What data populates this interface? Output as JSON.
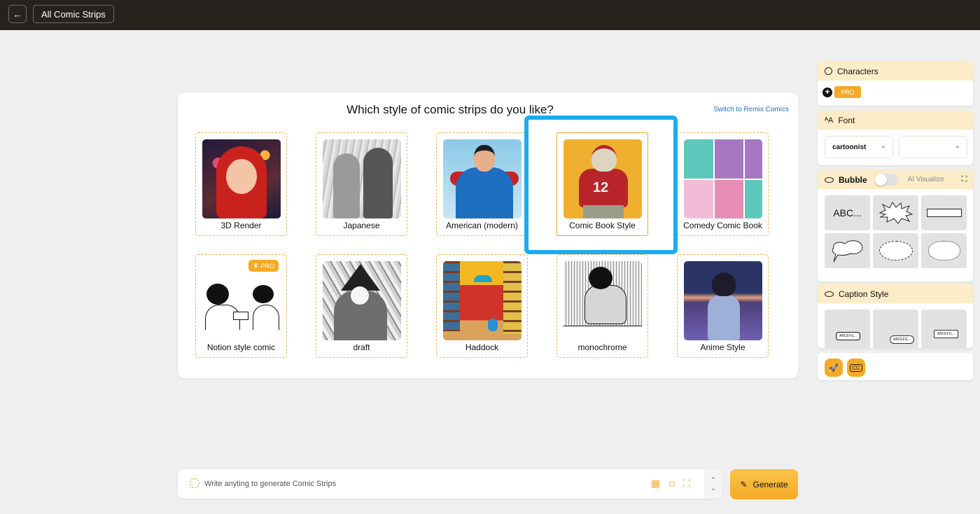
{
  "topbar": {
    "back_icon": "←",
    "breadcrumb_label": "All Comic Strips"
  },
  "main": {
    "title": "Which style of comic strips do you like?",
    "switch_link": "Switch to Remix Comics",
    "selected_style": "Comic Book Style",
    "styles": [
      {
        "label": "3D Render",
        "pro": false
      },
      {
        "label": "Japanese",
        "pro": false
      },
      {
        "label": "American (modern)",
        "pro": false
      },
      {
        "label": "Comic Book Style",
        "pro": false,
        "selected": true
      },
      {
        "label": "Comedy Comic Book",
        "pro": false
      },
      {
        "label": "Notion style comic",
        "pro": true
      },
      {
        "label": "draft",
        "pro": false
      },
      {
        "label": "Haddock",
        "pro": false
      },
      {
        "label": "monochrome",
        "pro": false
      },
      {
        "label": "Anime Style",
        "pro": false
      }
    ],
    "pro_badge": "PRO",
    "crown_icon": "♛"
  },
  "panel": {
    "characters": {
      "title": "Characters",
      "add_icon": "+",
      "pro_label": "PRO"
    },
    "font": {
      "title": "Font",
      "font_value": "cartoonist",
      "size_value": "",
      "chevron": "⌄"
    },
    "bubble": {
      "title": "Bubble",
      "toggle_on": false,
      "ai_label": "AI Visualize",
      "expand_icon": "⛶",
      "items": [
        "ABC...",
        "burst",
        "rectangle",
        "speech",
        "shout",
        "thought"
      ]
    },
    "caption": {
      "title": "Caption Style",
      "samples": [
        "ABCEFG...",
        "ABCEFG...",
        "ABCEFG..."
      ]
    },
    "tools": {
      "rocket_icon": "🚀",
      "cc_label": "CC"
    }
  },
  "prompt": {
    "placeholder": "Write anyting to generate Comic Strips",
    "value": "",
    "grid_icon": "▦",
    "emoji_icon": "☺",
    "scan_icon": "⛶",
    "up": "⌃",
    "down": "⌄"
  },
  "generate": {
    "label": "Generate",
    "brush_icon": "✎"
  },
  "colors": {
    "accent": "#f5aa25",
    "highlight": "#19adf0",
    "topbar": "#26221e",
    "panel_header": "#fcecc8"
  }
}
